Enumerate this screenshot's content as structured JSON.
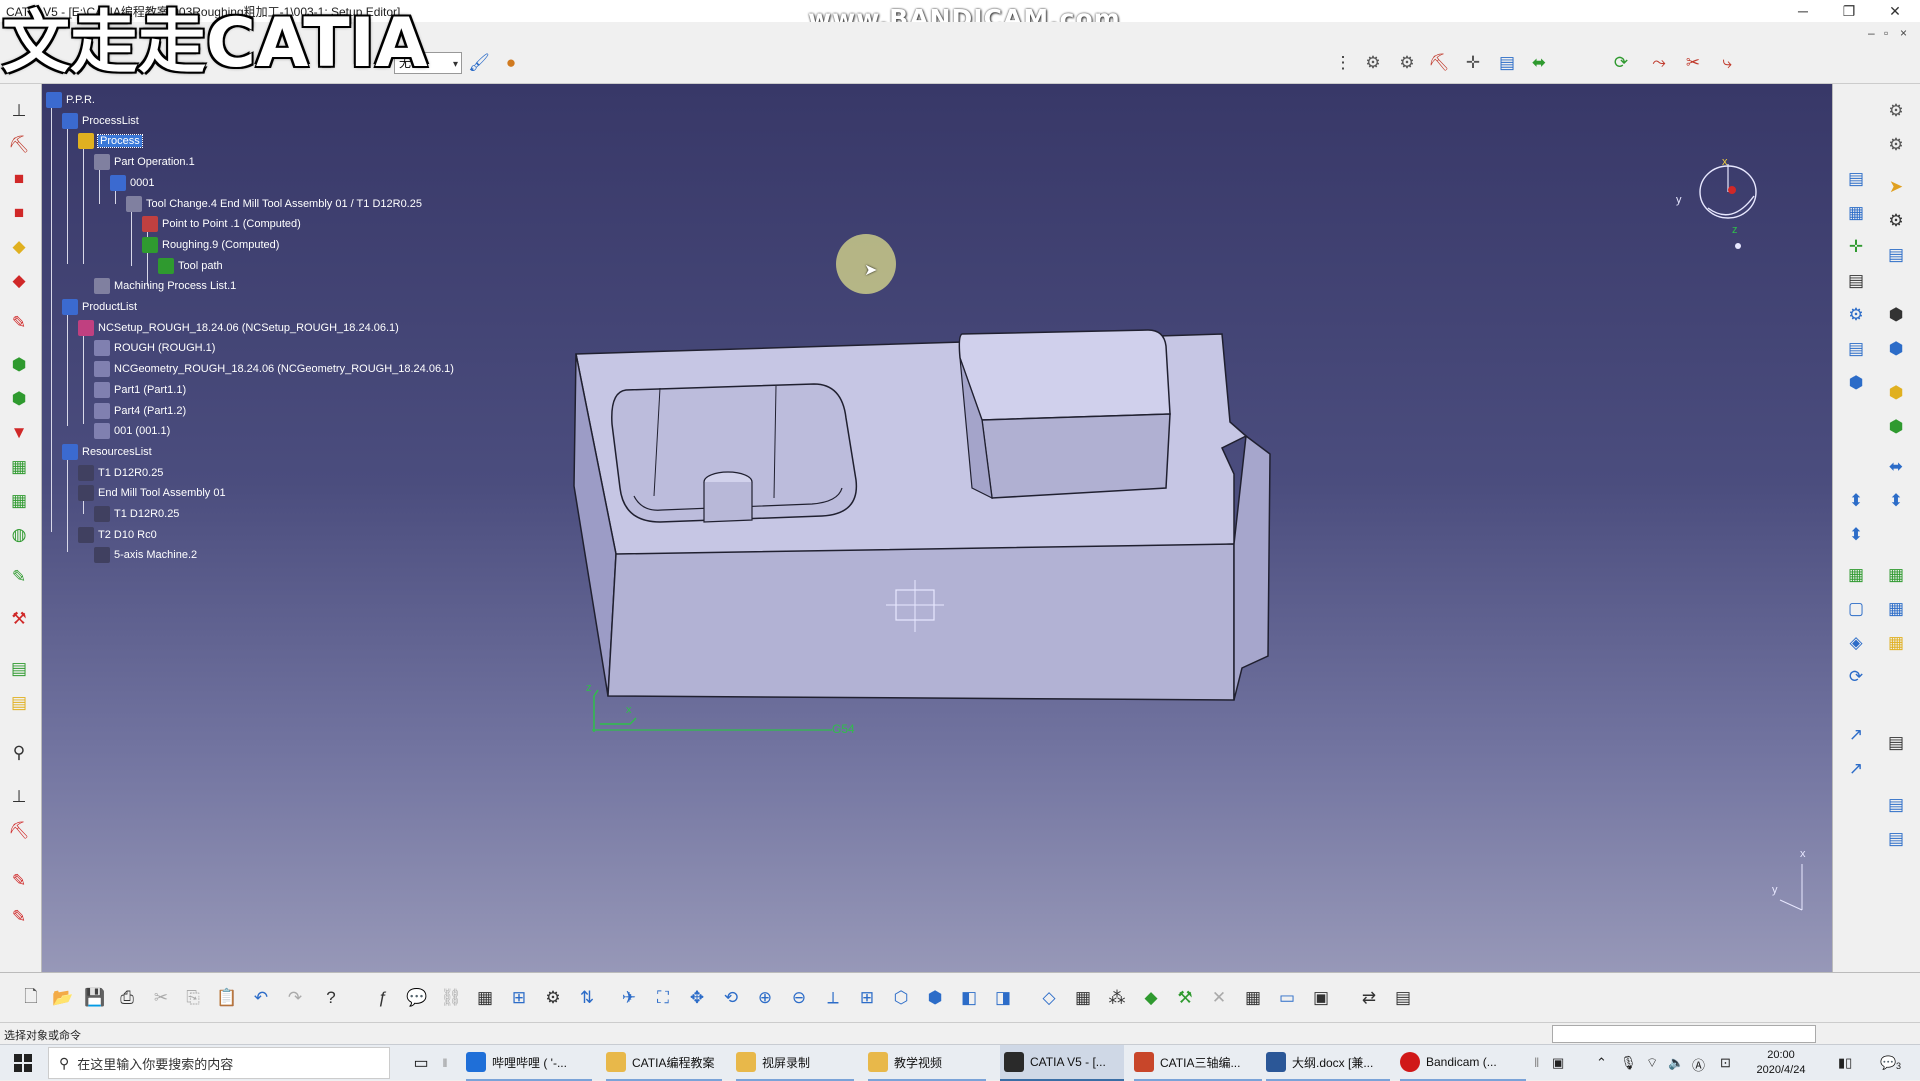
{
  "window": {
    "title": "CATIA V5 - [E:\\CATIA编程教案\\003Roughing粗加工-1\\003-1: Setup Editor]",
    "controls": {
      "minimize": "─",
      "restore": "❐",
      "close": "✕"
    },
    "inner_controls": {
      "minimize": "–",
      "restore": "▫",
      "close": "×"
    }
  },
  "overlays": {
    "recorder_watermark": "www.BANDICAM.com",
    "channel_logo": "文走走CATIA"
  },
  "toolbar_top": {
    "style_select": {
      "value": "无"
    }
  },
  "tree": {
    "items": [
      {
        "label": "P.P.R.",
        "icon": "ppr-icon"
      },
      {
        "label": "ProcessList",
        "icon": "process-list-icon"
      },
      {
        "label": "Process",
        "icon": "process-icon",
        "selected": true
      },
      {
        "label": "Part Operation.1",
        "icon": "part-operation-icon"
      },
      {
        "label": "0001",
        "icon": "program-icon"
      },
      {
        "label": "Tool Change.4  End Mill Tool Assembly 01 / T1 D12R0.25",
        "icon": "tool-change-icon"
      },
      {
        "label": "Point to Point .1 (Computed)",
        "icon": "point-to-point-icon"
      },
      {
        "label": "Roughing.9 (Computed)",
        "icon": "roughing-icon"
      },
      {
        "label": "Tool path",
        "icon": "tool-path-icon"
      },
      {
        "label": "Machining Process List.1",
        "icon": "machining-process-icon"
      },
      {
        "label": "ProductList",
        "icon": "product-list-icon"
      },
      {
        "label": "NCSetup_ROUGH_18.24.06 (NCSetup_ROUGH_18.24.06.1)",
        "icon": "product-icon"
      },
      {
        "label": "ROUGH (ROUGH.1)",
        "icon": "part-icon"
      },
      {
        "label": "NCGeometry_ROUGH_18.24.06 (NCGeometry_ROUGH_18.24.06.1)",
        "icon": "part-icon"
      },
      {
        "label": "Part1 (Part1.1)",
        "icon": "part-icon"
      },
      {
        "label": "Part4 (Part1.2)",
        "icon": "part-icon"
      },
      {
        "label": "001 (001.1)",
        "icon": "part-icon"
      },
      {
        "label": "ResourcesList",
        "icon": "resources-list-icon"
      },
      {
        "label": "T1 D12R0.25",
        "icon": "tool-icon"
      },
      {
        "label": "End Mill Tool Assembly 01",
        "icon": "tool-assembly-icon"
      },
      {
        "label": "T1 D12R0.25",
        "icon": "tool-icon"
      },
      {
        "label": "T2 D10 Rc0",
        "icon": "tool-icon"
      },
      {
        "label": "5-axis Machine.2",
        "icon": "machine-icon"
      }
    ]
  },
  "viewport": {
    "axis_label": "G54",
    "compass_labels": {
      "x": "x",
      "y": "y",
      "z": "z"
    },
    "mini_axis_labels": {
      "x": "x",
      "y": "y"
    }
  },
  "status_bar": {
    "text": "选择对象或命令"
  },
  "taskbar": {
    "search_placeholder": "在这里输入你要搜索的内容",
    "buttons": [
      {
        "label": "哔哩哔哩 ( '-...",
        "icon": "browser-icon",
        "color": "#1f6fd8"
      },
      {
        "label": "CATIA编程教案",
        "icon": "folder-icon",
        "color": "#e8b84a"
      },
      {
        "label": "视屏录制",
        "icon": "folder-icon",
        "color": "#e8b84a"
      },
      {
        "label": "教学视频",
        "icon": "folder-icon",
        "color": "#e8b84a"
      },
      {
        "label": "CATIA V5 - [...",
        "icon": "catia-icon",
        "color": "#2a2a2a"
      },
      {
        "label": "CATIA三轴编...",
        "icon": "powerpoint-icon",
        "color": "#c8462a"
      },
      {
        "label": "大纲.docx [兼...",
        "icon": "word-icon",
        "color": "#2b5797"
      },
      {
        "label": "Bandicam (...",
        "icon": "bandicam-icon",
        "color": "#d01818"
      }
    ],
    "clock": {
      "time": "20:00",
      "date": "2020/4/24"
    },
    "notification_count": "3"
  },
  "colors": {
    "viewport_top": "#383868",
    "viewport_bottom": "#9798b8",
    "part_face_top": "#c8c8e6",
    "part_face_front": "#b4b4d6",
    "selection": "#3a78d8"
  }
}
